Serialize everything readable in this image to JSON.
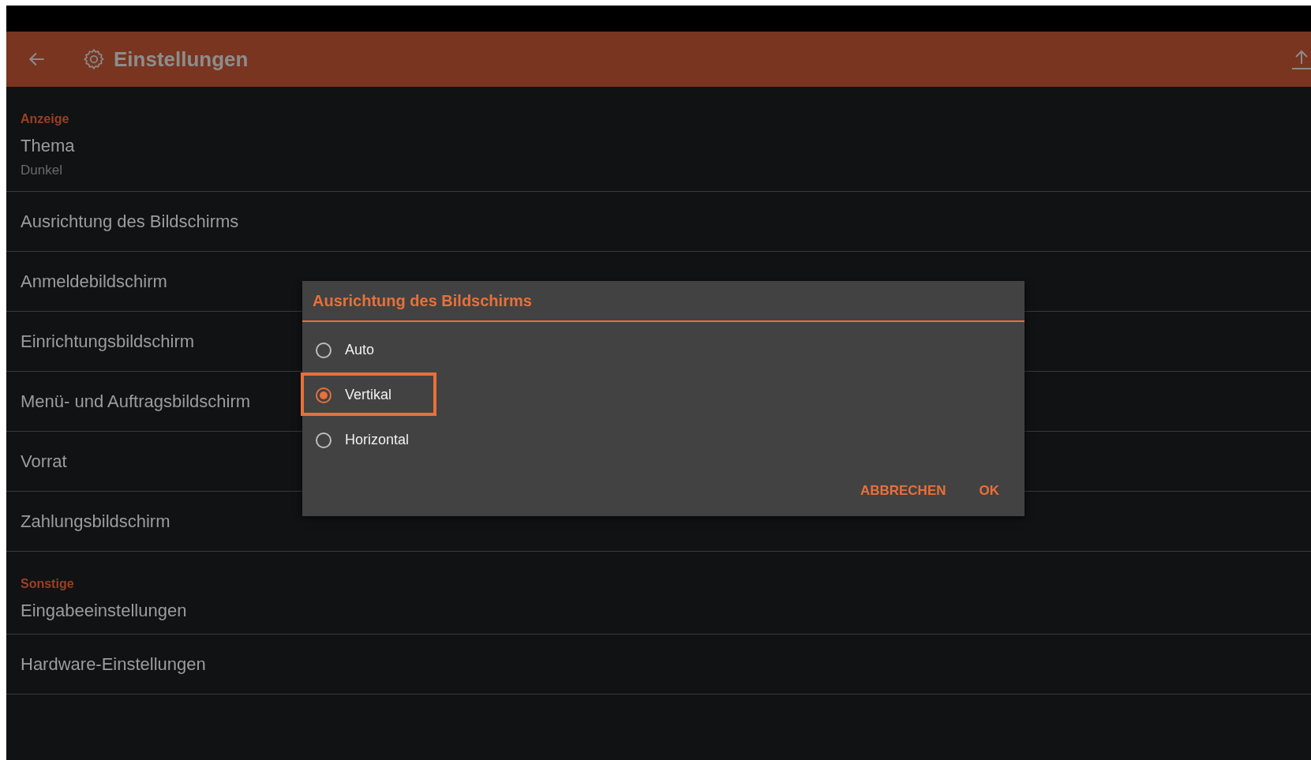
{
  "app_bar": {
    "title": "Einstellungen"
  },
  "sections": [
    {
      "header": "Anzeige",
      "items": [
        {
          "title": "Thema",
          "subtitle": "Dunkel"
        },
        {
          "title": "Ausrichtung des Bildschirms"
        },
        {
          "title": "Anmeldebildschirm"
        },
        {
          "title": "Einrichtungsbildschirm"
        },
        {
          "title": "Menü- und Auftragsbildschirm"
        },
        {
          "title": "Vorrat"
        },
        {
          "title": "Zahlungsbildschirm"
        }
      ]
    },
    {
      "header": "Sonstige",
      "items": [
        {
          "title": "Eingabeeinstellungen"
        },
        {
          "title": "Hardware-Einstellungen"
        }
      ]
    }
  ],
  "dialog": {
    "title": "Ausrichtung des Bildschirms",
    "options": [
      {
        "label": "Auto",
        "selected": false,
        "highlighted": false
      },
      {
        "label": "Vertikal",
        "selected": true,
        "highlighted": true
      },
      {
        "label": "Horizontal",
        "selected": false,
        "highlighted": false
      }
    ],
    "buttons": [
      "ABBRECHEN",
      "OK"
    ]
  }
}
